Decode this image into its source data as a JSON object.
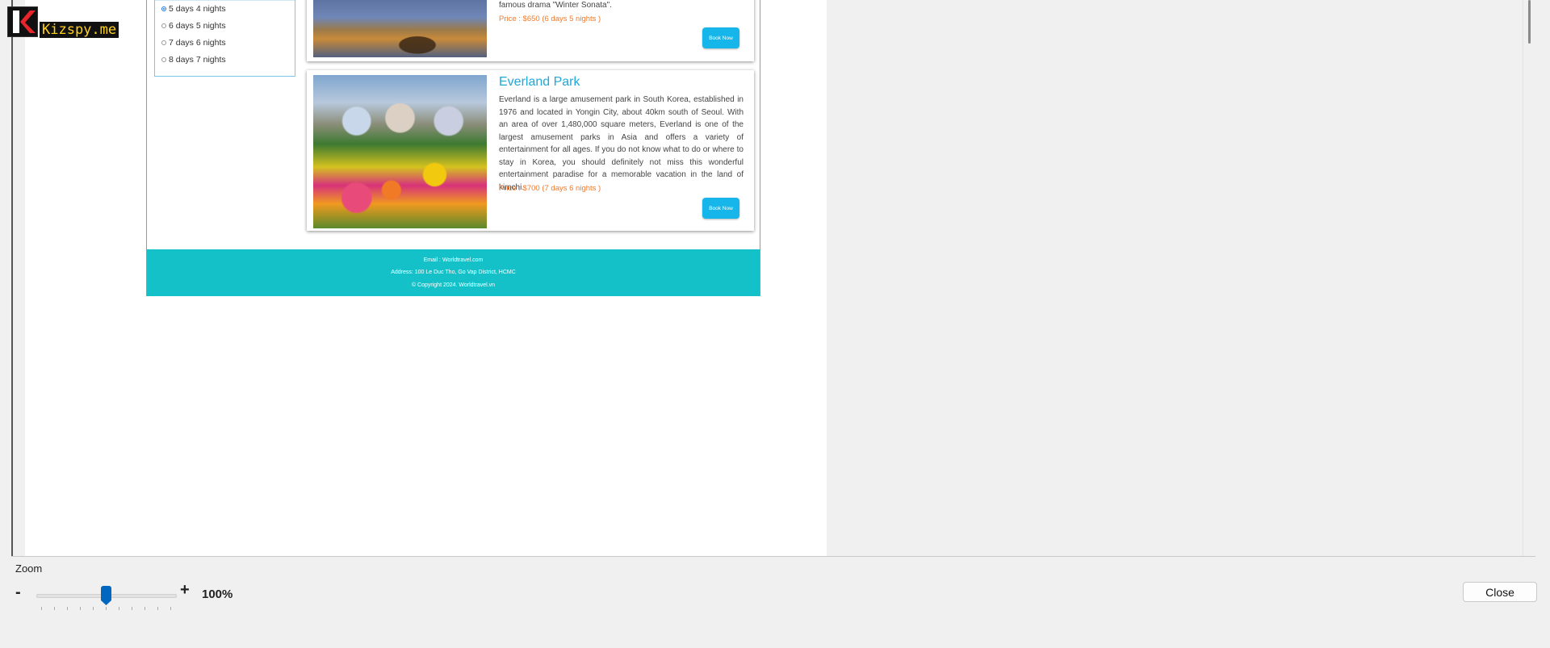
{
  "filter": {
    "options": [
      {
        "label": "5 days 4 nights",
        "selected": true
      },
      {
        "label": "6 days 5 nights",
        "selected": false
      },
      {
        "label": "7 days 6 nights",
        "selected": false
      },
      {
        "label": "8 days 7 nights",
        "selected": false
      }
    ]
  },
  "tours": [
    {
      "title": "",
      "description": "famous drama \"Winter Sonata\".",
      "price": "Price : $650 (6 days 5 nights )",
      "button": "Book Now"
    },
    {
      "title": "Everland Park",
      "description": "Everland is a large amusement park in South Korea, established in 1976 and located in Yongin City, about 40km south of Seoul. With an area of over 1,480,000 square meters, Everland is one of the largest amusement parks in Asia and offers a variety of entertainment for all ages. If you do not know what to do or where to stay in Korea, you should definitely not miss this wonderful entertainment paradise for a memorable vacation in the land of kimchi.",
      "price": "Price : $700 (7 days 6 nights )",
      "button": "Book Now"
    }
  ],
  "footer": {
    "email": "Email : Worldtravel.com",
    "address": "Address: 100 Le Duc Tho, Go Vap District, HCMC",
    "copyright": "© Copyright 2024. Worldtravel.vn"
  },
  "watermark": {
    "text": "Kizspy.me"
  },
  "zoom": {
    "label": "Zoom",
    "minus": "-",
    "plus": "+",
    "value": "100%",
    "level_fraction": 0.5
  },
  "dialog": {
    "close_label": "Close"
  },
  "colors": {
    "accent": "#16b6ea",
    "footer": "#14c1c8",
    "price": "#f07a2c",
    "title": "#1fa8d8"
  }
}
